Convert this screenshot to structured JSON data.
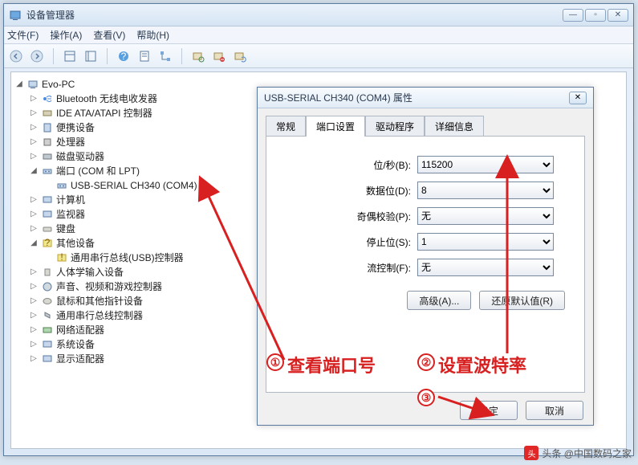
{
  "mainWindow": {
    "title": "设备管理器",
    "menu": {
      "file": "文件(F)",
      "action": "操作(A)",
      "view": "查看(V)",
      "help": "帮助(H)"
    }
  },
  "tree": {
    "root": "Evo-PC",
    "items": [
      "Bluetooth 无线电收发器",
      "IDE ATA/ATAPI 控制器",
      "便携设备",
      "处理器",
      "磁盘驱动器",
      "端口 (COM 和 LPT)",
      "USB-SERIAL CH340 (COM4)",
      "计算机",
      "监视器",
      "键盘",
      "其他设备",
      "通用串行总线(USB)控制器",
      "人体学输入设备",
      "声音、视频和游戏控制器",
      "鼠标和其他指针设备",
      "通用串行总线控制器",
      "网络适配器",
      "系统设备",
      "显示适配器"
    ]
  },
  "dialog": {
    "title": "USB-SERIAL CH340 (COM4) 属性",
    "tabs": {
      "general": "常规",
      "port": "端口设置",
      "driver": "驱动程序",
      "details": "详细信息"
    },
    "fields": {
      "baud_label": "位/秒(B):",
      "baud_value": "115200",
      "data_label": "数据位(D):",
      "data_value": "8",
      "parity_label": "奇偶校验(P):",
      "parity_value": "无",
      "stop_label": "停止位(S):",
      "stop_value": "1",
      "flow_label": "流控制(F):",
      "flow_value": "无"
    },
    "buttons": {
      "advanced": "高级(A)...",
      "restore": "还原默认值(R)",
      "ok": "确定",
      "cancel": "取消"
    }
  },
  "annotations": {
    "n1": "①",
    "t1": "查看端口号",
    "n2": "②",
    "t2": "设置波特率",
    "n3": "③"
  },
  "watermark": "头条 @中国数码之家"
}
